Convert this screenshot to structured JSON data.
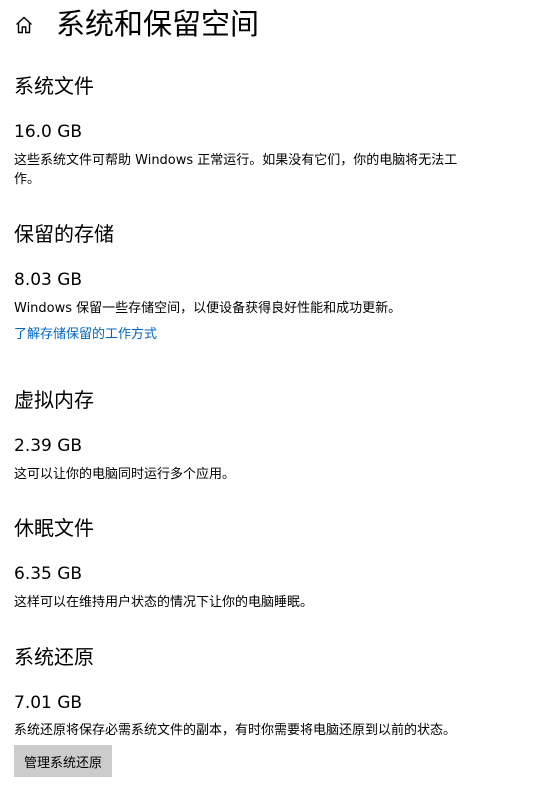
{
  "header": {
    "title": "系统和保留空间",
    "home_icon": "home-icon"
  },
  "sections": [
    {
      "heading": "系统文件",
      "size": "16.0 GB",
      "description": "这些系统文件可帮助 Windows 正常运行。如果没有它们，你的电脑将无法工作。"
    },
    {
      "heading": "保留的存储",
      "size": "8.03 GB",
      "description": "Windows 保留一些存储空间，以便设备获得良好性能和成功更新。",
      "link": "了解存储保留的工作方式"
    },
    {
      "heading": "虚拟内存",
      "size": "2.39 GB",
      "description": "这可以让你的电脑同时运行多个应用。"
    },
    {
      "heading": "休眠文件",
      "size": "6.35 GB",
      "description": "这样可以在维持用户状态的情况下让你的电脑睡眠。"
    },
    {
      "heading": "系统还原",
      "size": "7.01 GB",
      "description": "系统还原将保存必需系统文件的副本，有时你需要将电脑还原到以前的状态。",
      "button": "管理系统还原"
    }
  ],
  "colors": {
    "link": "#0067c0",
    "button_bg": "#cccccc"
  }
}
